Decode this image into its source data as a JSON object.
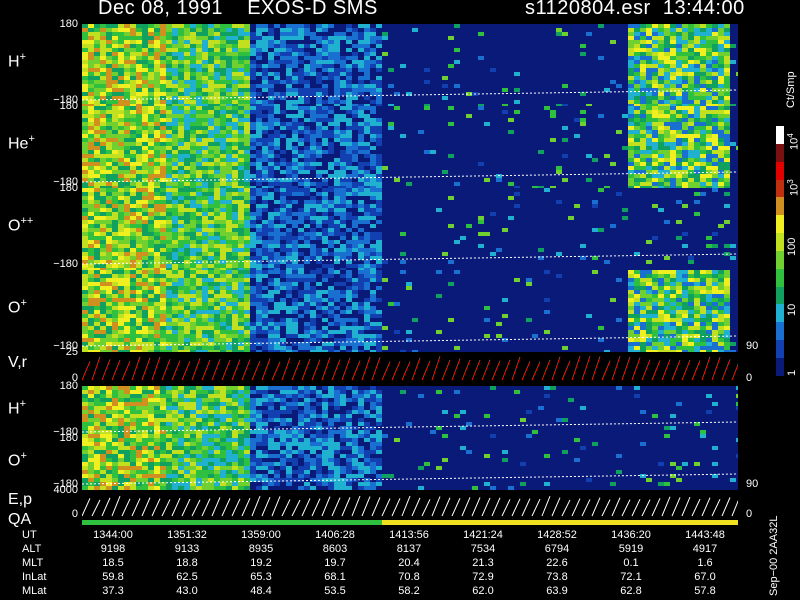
{
  "header": {
    "date": "Dec 08, 1991",
    "mission": "EXOS-D SMS",
    "file": "s1120804.esr",
    "time": "13:44:00"
  },
  "panels": [
    {
      "id": "hplus1",
      "label": "H",
      "sup": "+",
      "top_tick": "180",
      "bottom_tick": "−180",
      "right_tick": ""
    },
    {
      "id": "heplus",
      "label": "He",
      "sup": "+",
      "top_tick": "180",
      "bottom_tick": "−180",
      "right_tick": ""
    },
    {
      "id": "oplusplus",
      "label": "O",
      "sup": "++",
      "top_tick": "180",
      "bottom_tick": "−180",
      "right_tick": ""
    },
    {
      "id": "oplus1",
      "label": "O",
      "sup": "+",
      "top_tick": "",
      "bottom_tick": "−180",
      "right_tick": "90"
    },
    {
      "id": "vr",
      "label": "V,r",
      "sup": "",
      "top_tick": "25",
      "bottom_tick": "0",
      "right_tick": "0"
    },
    {
      "id": "hplus2",
      "label": "H",
      "sup": "+",
      "top_tick": "180",
      "bottom_tick": "−180",
      "right_tick": ""
    },
    {
      "id": "oplus2",
      "label": "O",
      "sup": "+",
      "top_tick": "180",
      "bottom_tick": "−180",
      "right_tick": "90"
    },
    {
      "id": "ep",
      "label": "E,p",
      "sup": "",
      "top_tick": "4000",
      "bottom_tick": "0",
      "right_tick": "0"
    }
  ],
  "qa_label": "QA",
  "colorbar": {
    "title": "Ct/Smp",
    "ticks": [
      "1",
      "10",
      "100",
      "10",
      "10"
    ],
    "tick_sups": [
      "",
      "",
      "",
      "3",
      "4"
    ],
    "colors": [
      "#0a1a78",
      "#1240b0",
      "#1a70d0",
      "#20b0d0",
      "#10a060",
      "#30c040",
      "#70d030",
      "#c0e020",
      "#f0f020",
      "#d09020",
      "#c03010",
      "#e00000",
      "#7a1010",
      "#ffffff"
    ]
  },
  "side_id": "Sep−00 2AA32L",
  "ephemeris": {
    "row_labels": [
      "UT",
      "ALT",
      "MLT",
      "InLat",
      "MLat"
    ],
    "columns": [
      [
        "1344:00",
        "9198",
        "18.5",
        "59.8",
        "37.3"
      ],
      [
        "1351:32",
        "9133",
        "18.8",
        "62.5",
        "43.0"
      ],
      [
        "1359:00",
        "8935",
        "19.2",
        "65.3",
        "48.4"
      ],
      [
        "1406:28",
        "8603",
        "19.7",
        "68.1",
        "53.5"
      ],
      [
        "1413:56",
        "8137",
        "20.4",
        "70.8",
        "58.2"
      ],
      [
        "1421:24",
        "7534",
        "21.3",
        "72.9",
        "62.0"
      ],
      [
        "1428:52",
        "6794",
        "22.6",
        "73.8",
        "63.9"
      ],
      [
        "1436:20",
        "5919",
        "0.1",
        "72.1",
        "62.8"
      ],
      [
        "1443:48",
        "4917",
        "1.6",
        "67.0",
        "57.8"
      ]
    ]
  },
  "chart_data": {
    "type": "heatmap",
    "title": "Dec 08, 1991   EXOS-D SMS",
    "xlabel": "UT",
    "x_ticks": [
      "1344:00",
      "1351:32",
      "1359:00",
      "1406:28",
      "1413:56",
      "1421:24",
      "1428:52",
      "1436:20",
      "1443:48"
    ],
    "colorbar_unit": "Ct/Smp",
    "colorbar_range": [
      1,
      10000
    ],
    "colorbar_scale": "log",
    "panels": [
      "H+",
      "He+",
      "O++",
      "O+",
      "V,r",
      "H+",
      "O+",
      "E,p"
    ],
    "panel_ylims": [
      [
        -180,
        180
      ],
      [
        -180,
        180
      ],
      [
        -180,
        180
      ],
      [
        -180,
        180
      ],
      [
        0,
        25
      ],
      [
        -180,
        180
      ],
      [
        -180,
        180
      ],
      [
        0,
        4000
      ]
    ]
  }
}
